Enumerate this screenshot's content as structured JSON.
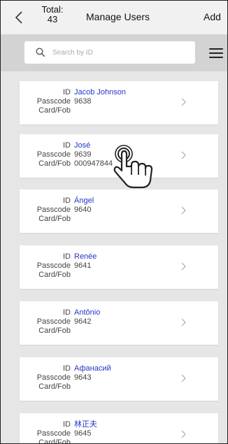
{
  "header": {
    "total_label": "Total:",
    "total_count": "43",
    "title": "Manage Users",
    "add_label": "Add"
  },
  "search": {
    "placeholder": "Search by ID"
  },
  "labels": {
    "id": "ID",
    "passcode": "Passcode",
    "card": "Card/Fob"
  },
  "users": [
    {
      "name": "Jacob Johnson",
      "passcode": "9638",
      "card": ""
    },
    {
      "name": "José",
      "passcode": "9639",
      "card": "000947844"
    },
    {
      "name": "Ángel",
      "passcode": "9640",
      "card": ""
    },
    {
      "name": "Renée",
      "passcode": "9641",
      "card": ""
    },
    {
      "name": "Antônio",
      "passcode": "9642",
      "card": ""
    },
    {
      "name": "Афанасий",
      "passcode": "9643",
      "card": ""
    },
    {
      "name": "林正夫",
      "passcode": "9645",
      "card": ""
    }
  ],
  "colors": {
    "name_link": "#2435c8",
    "header_bg": "#f1f1f1",
    "search_bar_bg": "#d3d3d3",
    "list_bg": "#e6e6e6"
  },
  "icons": {
    "back": "chevron-left-icon",
    "search": "search-icon",
    "menu": "hamburger-menu-icon",
    "row_chevron": "chevron-right-icon",
    "pointer": "hand-pointer-icon"
  }
}
